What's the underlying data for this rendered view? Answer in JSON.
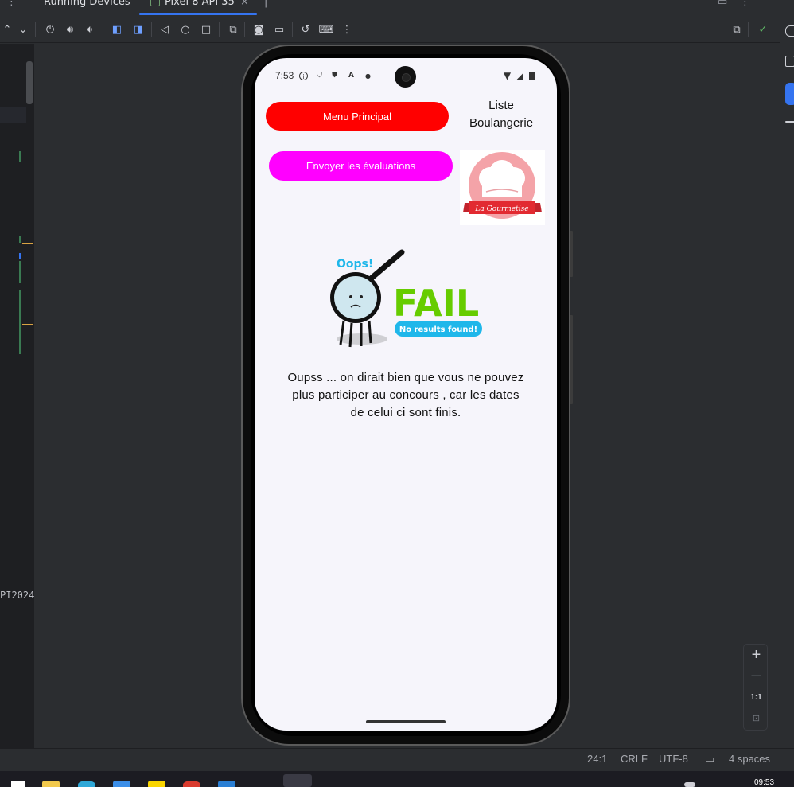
{
  "tabs": {
    "running_devices": "Running Devices",
    "device_tab": "Pixel 8 API 35",
    "close": "×"
  },
  "toolbar": {
    "icons": [
      "power-icon",
      "volume-up-icon",
      "volume-down-icon",
      "rotate-left-icon",
      "rotate-right-icon",
      "back-icon",
      "home-icon",
      "overview-icon",
      "device-manager-icon",
      "screenshot-icon",
      "screen-record-icon",
      "reset-icon",
      "keyboard-icon",
      "more-icon"
    ],
    "right_icons": [
      "mirror-icon",
      "check-icon"
    ]
  },
  "editor": {
    "code_fragment": "PI2024"
  },
  "app": {
    "status_time": "7:53",
    "menu_button": "Menu Principal",
    "liste_link_line1": "Liste",
    "liste_link_line2": "Boulangerie",
    "eval_button": "Envoyer les évaluations",
    "logo_text": "La Gourmetise",
    "fail_oops": "Oops!",
    "fail_title": "FAIL",
    "fail_subtitle": "No results found!",
    "message": "Oupss ... on dirait bien que vous ne pouvez plus participer au concours , car les dates de celui ci sont finis.",
    "colors": {
      "menu_button": "#ff0000",
      "eval_button": "#ff00ff",
      "fail_green": "#66cc00",
      "fail_blue": "#1fb7ea",
      "screen_bg": "#f6f5fb"
    }
  },
  "zoom": {
    "plus": "+",
    "minus": "—",
    "one_to_one": "1:1"
  },
  "statusbar": {
    "position": "24:1",
    "line_ending": "CRLF",
    "encoding": "UTF-8",
    "indent": "4 spaces"
  },
  "taskbar": {
    "clock": "09:53"
  }
}
